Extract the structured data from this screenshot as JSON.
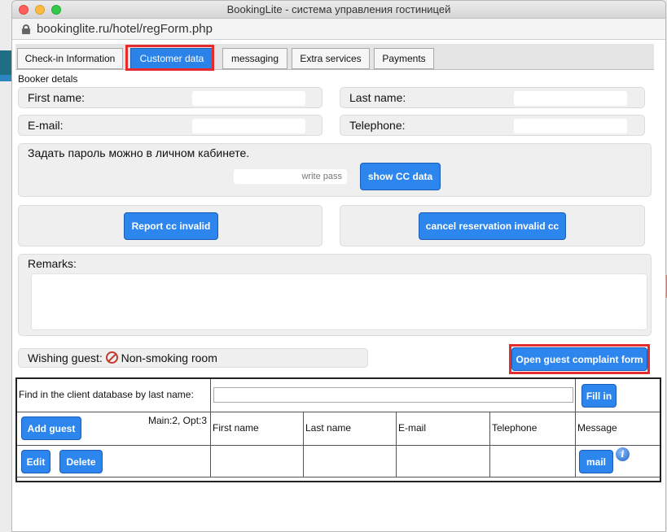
{
  "window": {
    "title": "BookingLite - система управления гостиницей",
    "url": "bookinglite.ru/hotel/regForm.php"
  },
  "tabs": [
    {
      "label": "Check-in Information"
    },
    {
      "label": "Customer data"
    },
    {
      "label": "messaging"
    },
    {
      "label": "Extra services"
    },
    {
      "label": "Payments"
    }
  ],
  "booker": {
    "section_title": "Booker detals",
    "first_name_label": "First name:",
    "last_name_label": "Last name:",
    "email_label": "E-mail:",
    "telephone_label": "Telephone:"
  },
  "password": {
    "note": "Задать пароль можно в личном кабинете.",
    "field_placeholder": "write pass",
    "show_cc_button": "show CC data"
  },
  "actions": {
    "report_cc_button": "Report cc invalid",
    "cancel_reservation_button": "cancel reservation invalid cc"
  },
  "remarks": {
    "label": "Remarks:"
  },
  "wishing": {
    "label": "Wishing guest:",
    "value": "Non-smoking room",
    "icon": "no-smoking-icon"
  },
  "complaint": {
    "button": "Open guest complaint form"
  },
  "client_db": {
    "find_label": "Find in the client database by last name:",
    "fill_button": "Fill in",
    "add_guest_button": "Add guest",
    "counts": "Main:2, Opt:3",
    "columns": [
      "First name",
      "Last name",
      "E-mail",
      "Telephone",
      "Message"
    ],
    "edit_button": "Edit",
    "delete_button": "Delete",
    "mail_button": "mail"
  },
  "colors": {
    "accent": "#2b83ea",
    "highlight": "#e52b2b"
  }
}
